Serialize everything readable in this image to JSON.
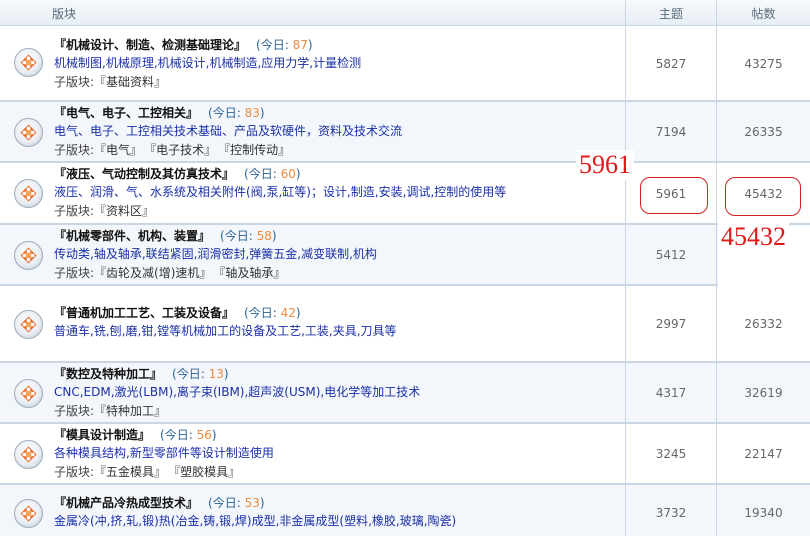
{
  "header": {
    "board": "版块",
    "topics": "主题",
    "posts": "帖数"
  },
  "today_prefix": "(今日: ",
  "today_suffix": ")",
  "sub_prefix": "子版块:",
  "rows": [
    {
      "title": "『机械设计、制造、检测基础理论』",
      "today": "87",
      "desc": "机械制图,机械原理,机械设计,机械制造,应用力学,计量检测",
      "subs": [
        "『基础资料』"
      ],
      "topics": "5827",
      "posts": "43275"
    },
    {
      "title": "『电气、电子、工控相关』",
      "today": "83",
      "desc": "电气、电子、工控相关技术基础、产品及软硬件，资料及技术交流",
      "subs": [
        "『电气』",
        "『电子技术』",
        "『控制传动』"
      ],
      "topics": "7194",
      "posts": "26335"
    },
    {
      "title": "『液压、气动控制及其仿真技术』",
      "today": "60",
      "desc": "液压、润滑、气、水系统及相关附件(阀,泵,缸等)；设计,制造,安装,调试,控制的使用等",
      "subs": [
        "『资料区』"
      ],
      "topics": "5961",
      "posts": "45432"
    },
    {
      "title": "『机械零部件、机构、装置』",
      "today": "58",
      "desc": "传动类,轴及轴承,联结紧固,润滑密封,弹簧五金,减变联制,机构",
      "subs": [
        "『齿轮及减(增)速机』",
        "『轴及轴承』"
      ],
      "topics": "5412",
      "posts": ""
    },
    {
      "title": "『普通机加工工艺、工装及设备』",
      "today": "42",
      "desc": "普通车,铣,刨,磨,钳,镗等机械加工的设备及工艺,工装,夹具,刀具等",
      "subs": [],
      "topics": "2997",
      "posts": "26332"
    },
    {
      "title": "『数控及特种加工』",
      "today": "13",
      "desc": "CNC,EDM,激光(LBM),离子束(IBM),超声波(USM),电化学等加工技术",
      "subs": [
        "『特种加工』"
      ],
      "topics": "4317",
      "posts": "32619"
    },
    {
      "title": "『模具设计制造』",
      "today": "56",
      "desc": "各种模具结构,新型零部件等设计制造使用",
      "subs": [
        "『五金模具』",
        "『塑胶模具』"
      ],
      "topics": "3245",
      "posts": "22147"
    },
    {
      "title": "『机械产品冷热成型技术』",
      "today": "53",
      "desc": "金属冷(冲,挤,轧,锻)热(冶金,铸,锻,焊)成型,非金属成型(塑料,橡胶,玻璃,陶瓷)",
      "subs": [],
      "topics": "3732",
      "posts": "19340"
    }
  ],
  "annotations": {
    "topics_value": "5961",
    "posts_value": "45432"
  },
  "colors": {
    "header_bg": "#e7eef5",
    "border": "#c9d7e5",
    "link_blue": "#1a2fa8",
    "today_orange": "#f08a3c",
    "annotation_red": "#e01818"
  }
}
